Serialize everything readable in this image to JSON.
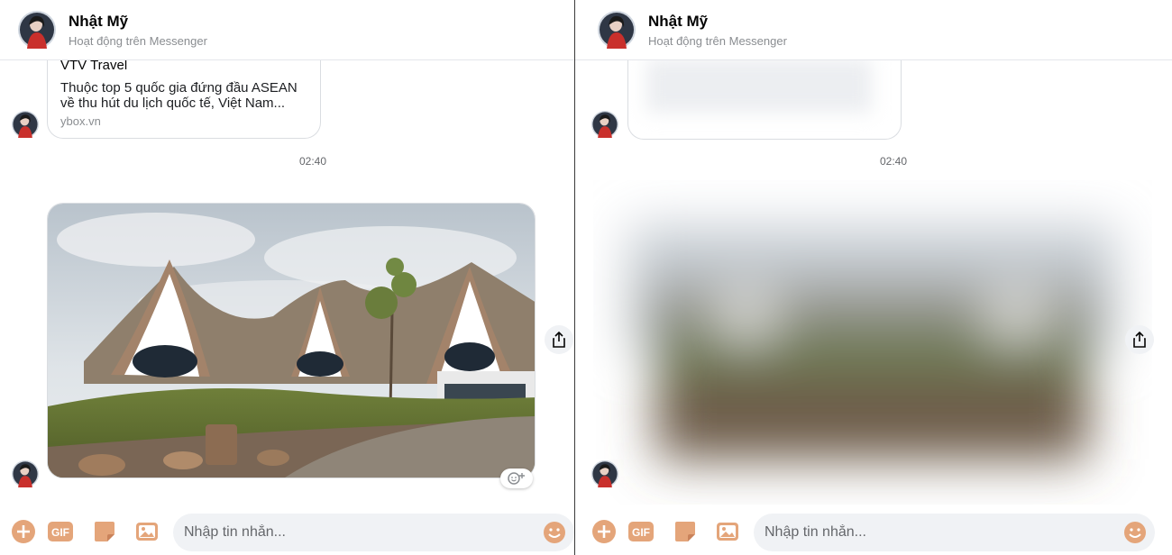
{
  "contact": {
    "name": "Nhật Mỹ",
    "status": "Hoạt động trên Messenger"
  },
  "link_card": {
    "title": "VTV Travel",
    "desc_line1": "Thuộc top 5 quốc gia đứng đầu ASEAN",
    "desc_line2": "về thu hút du lịch quốc tế, Việt Nam...",
    "domain": "ybox.vn"
  },
  "timestamp": "02:40",
  "composer": {
    "placeholder": "Nhập tin nhắn...",
    "gif_label": "GIF"
  },
  "icons": {
    "add": "plus-circle-icon",
    "gif": "gif-icon",
    "sticker": "sticker-icon",
    "image": "image-icon",
    "emoji": "emoji-icon",
    "share": "share-icon",
    "react": "add-reaction-icon"
  },
  "colors": {
    "accent": "#e4a57a",
    "input_bg": "#f0f2f5",
    "muted_text": "#65676b"
  }
}
